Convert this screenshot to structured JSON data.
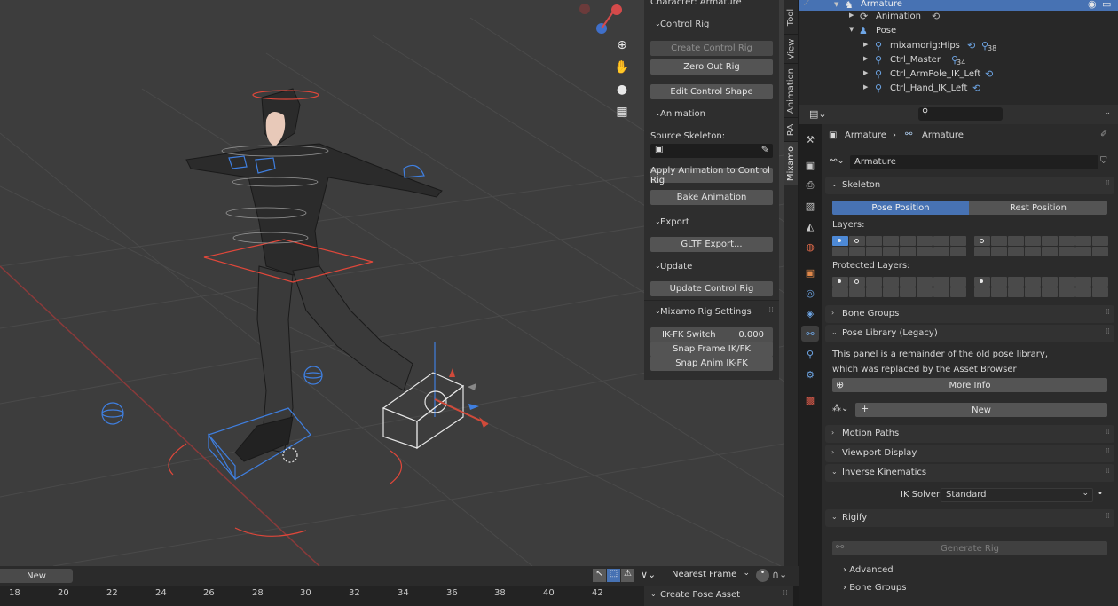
{
  "npanel": {
    "title": "Character: Armature",
    "control_rig_header": "Control Rig",
    "create_control_rig": "Create Control Rig",
    "zero_out_rig": "Zero Out Rig",
    "edit_control_shape": "Edit Control Shape",
    "animation_header": "Animation",
    "source_skeleton_label": "Source Skeleton:",
    "apply_animation": "Apply Animation to Control Rig",
    "bake_animation": "Bake Animation",
    "export_header": "Export",
    "gltf_export": "GLTF Export...",
    "update_header": "Update",
    "update_control_rig": "Update Control Rig",
    "rig_settings_header": "Mixamo Rig Settings",
    "ik_fk_switch_label": "IK-FK Switch",
    "ik_fk_switch_value": "0.000",
    "snap_frame": "Snap Frame IK/FK",
    "snap_anim": "Snap Anim IK-FK"
  },
  "vertical_tabs": [
    "Tool",
    "View",
    "Animation",
    "RA",
    "Mixamo"
  ],
  "outliner": {
    "rows": [
      {
        "label": "Armature"
      },
      {
        "label": "Animation"
      },
      {
        "label": "Pose"
      },
      {
        "label": "mixamorig:Hips",
        "badge": "38"
      },
      {
        "label": "Ctrl_Master",
        "badge": "34"
      },
      {
        "label": "Ctrl_ArmPole_IK_Left"
      },
      {
        "label": "Ctrl_Hand_IK_Left"
      }
    ]
  },
  "properties": {
    "breadcrumb_object": "Armature",
    "breadcrumb_data": "Armature",
    "data_name": "Armature",
    "skeleton_header": "Skeleton",
    "pose_position": "Pose Position",
    "rest_position": "Rest Position",
    "layers_label": "Layers:",
    "protected_layers_label": "Protected Layers:",
    "bone_groups_header": "Bone Groups",
    "pose_library_header": "Pose Library (Legacy)",
    "pose_library_text_1": "This panel is a remainder of the old pose library,",
    "pose_library_text_2": "which was replaced by the Asset Browser",
    "more_info": "More Info",
    "new_button": "New",
    "motion_paths_header": "Motion Paths",
    "viewport_display_header": "Viewport Display",
    "ik_header": "Inverse Kinematics",
    "ik_solver_label": "IK Solver",
    "ik_solver_value": "Standard",
    "rigify_header": "Rigify",
    "generate_rig": "Generate Rig",
    "advanced": "Advanced",
    "rigify_bone_groups": "Bone Groups"
  },
  "timeline": {
    "new_button": "New",
    "snap_mode": "Nearest Frame",
    "frames": [
      "18",
      "20",
      "22",
      "24",
      "26",
      "28",
      "30",
      "32",
      "34",
      "36",
      "38",
      "40",
      "42"
    ],
    "create_pose_asset": "Create Pose Asset"
  },
  "colors": {
    "accent": "#4772b3",
    "selection": "#4d89d6",
    "control_red": "#e0473a",
    "control_blue": "#3f7fe0"
  }
}
